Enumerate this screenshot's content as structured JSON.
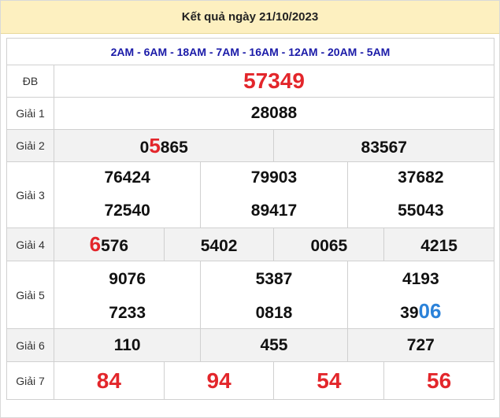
{
  "header": {
    "title": "Kết quả ngày 21/10/2023"
  },
  "codes": "2AM - 6AM - 18AM - 7AM - 16AM - 12AM - 20AM - 5AM",
  "labels": {
    "db": "ĐB",
    "g1": "Giải 1",
    "g2": "Giải 2",
    "g3": "Giải 3",
    "g4": "Giải 4",
    "g5": "Giải 5",
    "g6": "Giải 6",
    "g7": "Giải 7"
  },
  "prizes": {
    "db": "57349",
    "g1": "28088",
    "g2": [
      {
        "pre": "0",
        "hl": "5",
        "post": "865"
      },
      {
        "pre": "83567",
        "hl": "",
        "post": ""
      }
    ],
    "g3": [
      "76424",
      "79903",
      "37682",
      "72540",
      "89417",
      "55043"
    ],
    "g4": [
      {
        "pre": "",
        "hl": "6",
        "post": "576"
      },
      {
        "pre": "5402",
        "hl": "",
        "post": ""
      },
      {
        "pre": "0065",
        "hl": "",
        "post": ""
      },
      {
        "pre": "4215",
        "hl": "",
        "post": ""
      }
    ],
    "g5": [
      {
        "pre": "9076",
        "hl": "",
        "post": ""
      },
      {
        "pre": "5387",
        "hl": "",
        "post": ""
      },
      {
        "pre": "4193",
        "hl": "",
        "post": ""
      },
      {
        "pre": "7233",
        "hl": "",
        "post": ""
      },
      {
        "pre": "0818",
        "hl": "",
        "post": ""
      },
      {
        "pre": "39",
        "hl": "06",
        "post": ""
      }
    ],
    "g6": [
      "110",
      "455",
      "727"
    ],
    "g7": [
      "84",
      "94",
      "54",
      "56"
    ]
  },
  "colors": {
    "red": "#e3262b",
    "blue": "#2b82d9",
    "header_bg": "#fdf0c0",
    "codes": "#1a1aa8"
  }
}
